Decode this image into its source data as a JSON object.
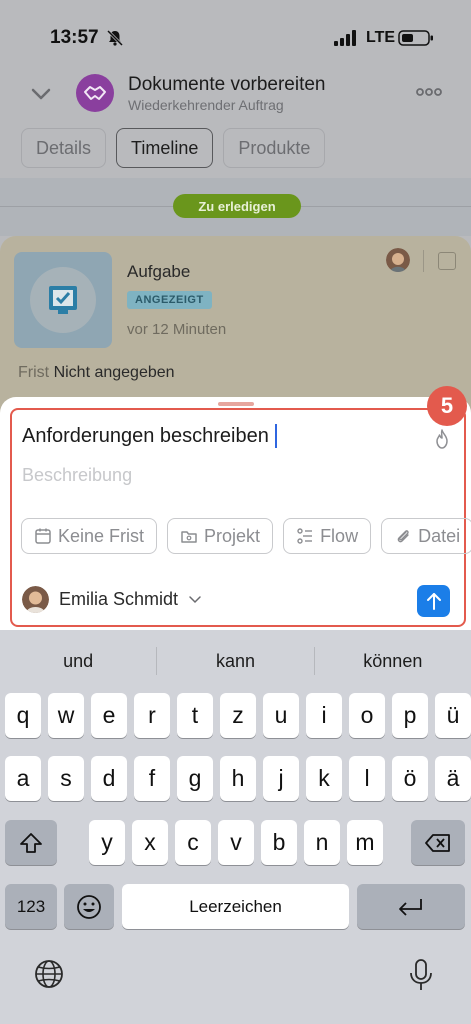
{
  "status": {
    "time": "13:57",
    "network": "LTE"
  },
  "header": {
    "title": "Dokumente vorbereiten",
    "subtitle": "Wiederkehrender Auftrag"
  },
  "tabs": [
    {
      "label": "Details",
      "active": false
    },
    {
      "label": "Timeline",
      "active": true
    },
    {
      "label": "Produkte",
      "active": false
    }
  ],
  "timeline": {
    "pill": "Zu erledigen"
  },
  "task_card": {
    "type": "Aufgabe",
    "badge": "ANGEZEIGT",
    "time": "vor 12 Minuten",
    "deadline_label": "Frist",
    "deadline_value": "Nicht angegeben"
  },
  "sheet": {
    "step_number": "5",
    "title_value": "Anforderungen beschreiben",
    "description_placeholder": "Beschreibung",
    "chips": [
      "Keine Frist",
      "Projekt",
      "Flow",
      "Datei"
    ],
    "assignee": "Emilia Schmidt"
  },
  "keyboard": {
    "suggestions": [
      "und",
      "kann",
      "können"
    ],
    "row1": [
      "q",
      "w",
      "e",
      "r",
      "t",
      "z",
      "u",
      "i",
      "o",
      "p",
      "ü"
    ],
    "row2": [
      "a",
      "s",
      "d",
      "f",
      "g",
      "h",
      "j",
      "k",
      "l",
      "ö",
      "ä"
    ],
    "row3": [
      "y",
      "x",
      "c",
      "v",
      "b",
      "n",
      "m"
    ],
    "numbers_label": "123",
    "space_label": "Leerzeichen"
  },
  "colors": {
    "accent_blue": "#1b7ee8",
    "highlight_red": "#e35a4d",
    "todo_green": "#6a961c"
  }
}
